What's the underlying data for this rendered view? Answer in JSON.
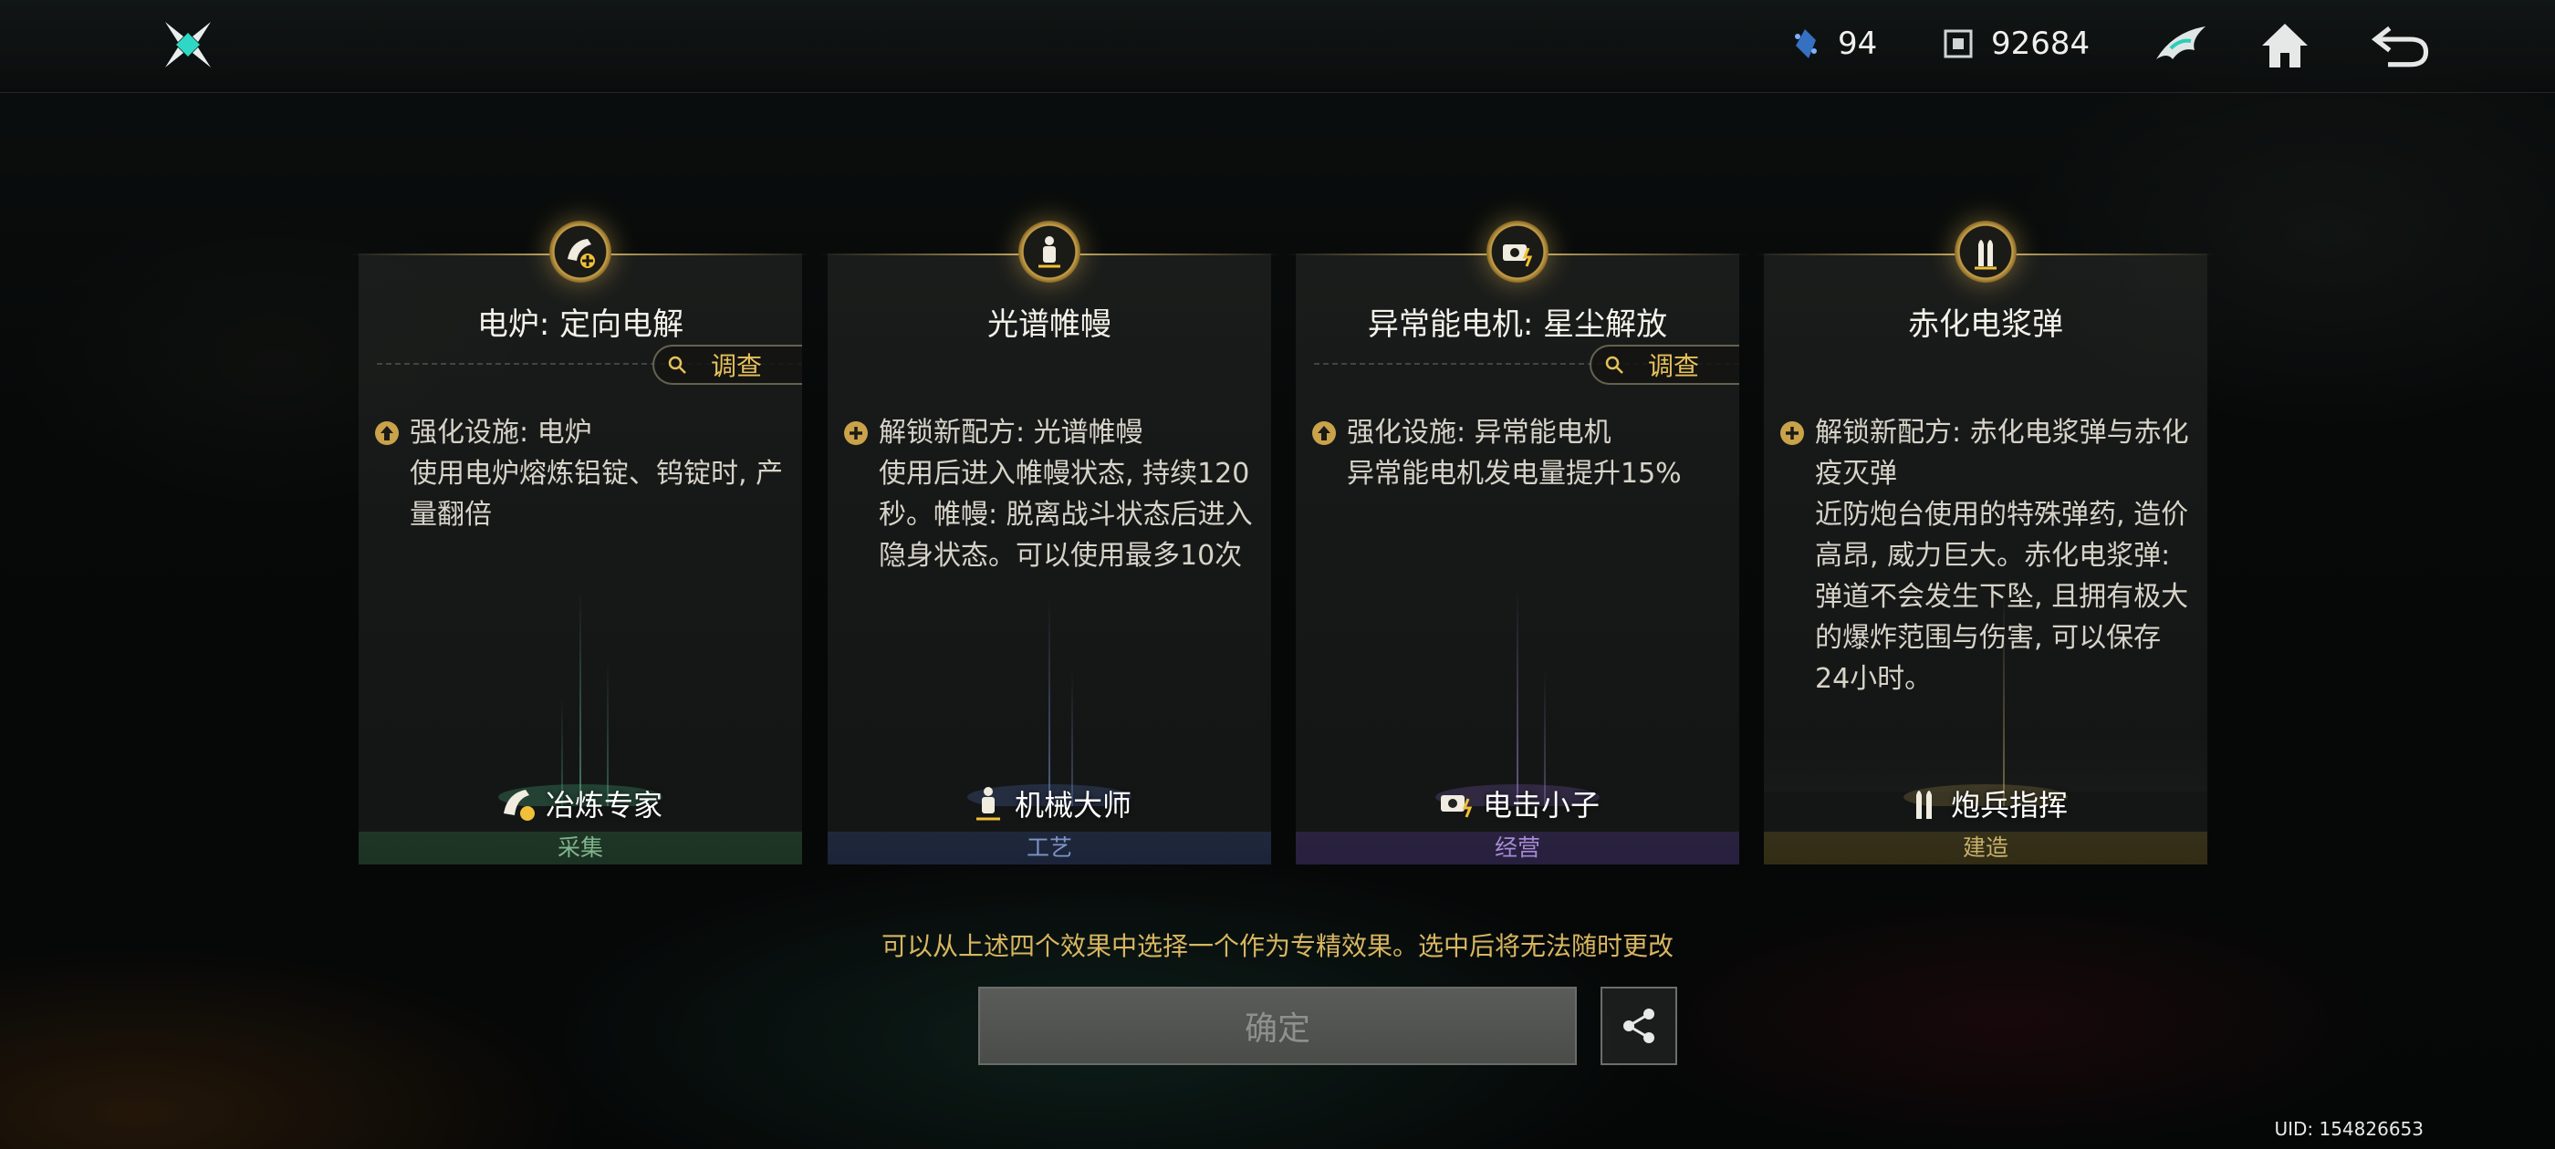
{
  "topbar": {
    "currency1": {
      "icon": "crystal-icon",
      "value": "94"
    },
    "currency2": {
      "icon": "cube-coin-icon",
      "value": "92684"
    },
    "buttons": [
      "emblem-icon",
      "home-icon",
      "back-icon"
    ]
  },
  "cards": [
    {
      "title": "电炉: 定向电解",
      "investigate_label": "调查",
      "effect_head": "强化设施: 电炉",
      "effect_body": "使用电炉熔炼铝锭、钨锭时, 产量翻倍",
      "role": "冶炼专家",
      "category": "采集"
    },
    {
      "title": "光谱帷幔",
      "effect_head": "解锁新配方: 光谱帷幔",
      "effect_body": "使用后进入帷幔状态, 持续120秒。帷幔: 脱离战斗状态后进入隐身状态。可以使用最多10次",
      "role": "机械大师",
      "category": "工艺"
    },
    {
      "title": "异常能电机: 星尘解放",
      "investigate_label": "调查",
      "effect_head": "强化设施: 异常能电机",
      "effect_body": "异常能电机发电量提升15%",
      "role": "电击小子",
      "category": "经营"
    },
    {
      "title": "赤化电浆弹",
      "effect_head": "解锁新配方: 赤化电浆弹与赤化疫灭弹",
      "effect_body": "近防炮台使用的特殊弹药, 造价高昂, 威力巨大。赤化电浆弹: 弹道不会发生下坠, 且拥有极大的爆炸范围与伤害, 可以保存24小时。",
      "role": "炮兵指挥",
      "category": "建造"
    }
  ],
  "hint": "可以从上述四个效果中选择一个作为专精效果。选中后将无法随时更改",
  "confirm_label": "确定",
  "uid": "UID: 154826653",
  "colors": {
    "accent_gold": "#d8b660",
    "green": "#7fb58d",
    "blue": "#7f95c8",
    "purple": "#a58ad6",
    "gold": "#c8b06a"
  }
}
